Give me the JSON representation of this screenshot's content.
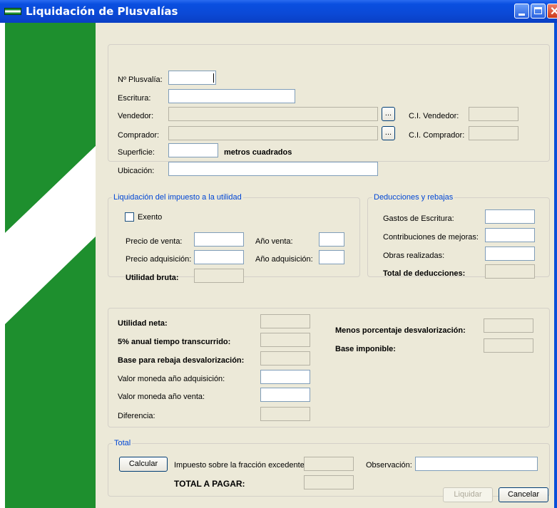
{
  "window": {
    "title": "Liquidación de Plusvalías"
  },
  "colors": {
    "accent_green": "#1e8f2e",
    "title_blue": "#0a4fd8",
    "group_title": "#0046d5",
    "form_bg": "#ece9d8"
  },
  "top": {
    "nplusvalia_label": "Nº Plusvalía:",
    "nplusvalia_value": "",
    "escritura_label": "Escritura:",
    "escritura_value": "",
    "vendedor_label": "Vendedor:",
    "vendedor_value": "",
    "vendedor_browse": "...",
    "ci_vendedor_label": "C.I. Vendedor:",
    "ci_vendedor_value": "",
    "comprador_label": "Comprador:",
    "comprador_value": "",
    "comprador_browse": "...",
    "ci_comprador_label": "C.I. Comprador:",
    "ci_comprador_value": "",
    "superficie_label": "Superficie:",
    "superficie_value": "",
    "superficie_unit": "metros cuadrados",
    "ubicacion_label": "Ubicación:",
    "ubicacion_value": ""
  },
  "liquidacion": {
    "title": "Liquidación del impuesto a la utilidad",
    "exento_label": "Exento",
    "exento_checked": false,
    "precio_venta_label": "Precio de venta:",
    "precio_adquisicion_label": "Precio adquisición:",
    "utilidad_bruta_label": "Utilidad bruta:",
    "anio_venta_label": "Año venta:",
    "anio_adquisicion_label": "Año adquisición:"
  },
  "deducciones": {
    "title": "Deducciones y rebajas",
    "gastos_label": "Gastos de Escritura:",
    "contribuciones_label": "Contribuciones de mejoras:",
    "obras_label": "Obras realizadas:",
    "total_label": "Total de deducciones:"
  },
  "calculo": {
    "utilidad_neta_label": "Utilidad neta:",
    "anual_label": "5% anual tiempo transcurrido:",
    "base_rebaja_label": "Base para rebaja desvalorización:",
    "valor_adq_label": "Valor moneda año adquisición:",
    "valor_venta_label": "Valor moneda año venta:",
    "diferencia_label": "Diferencia:",
    "menos_porcentaje_label": "Menos porcentaje desvalorización:",
    "base_imponible_label": "Base imponible:"
  },
  "total": {
    "title": "Total",
    "calcular_label": "Calcular",
    "impuesto_label": "Impuesto sobre la fracción excedente:",
    "observacion_label": "Observación:",
    "total_pagar_label": "TOTAL A PAGAR:"
  },
  "footer": {
    "liquidar_label": "Liquidar",
    "cancelar_label": "Cancelar"
  }
}
